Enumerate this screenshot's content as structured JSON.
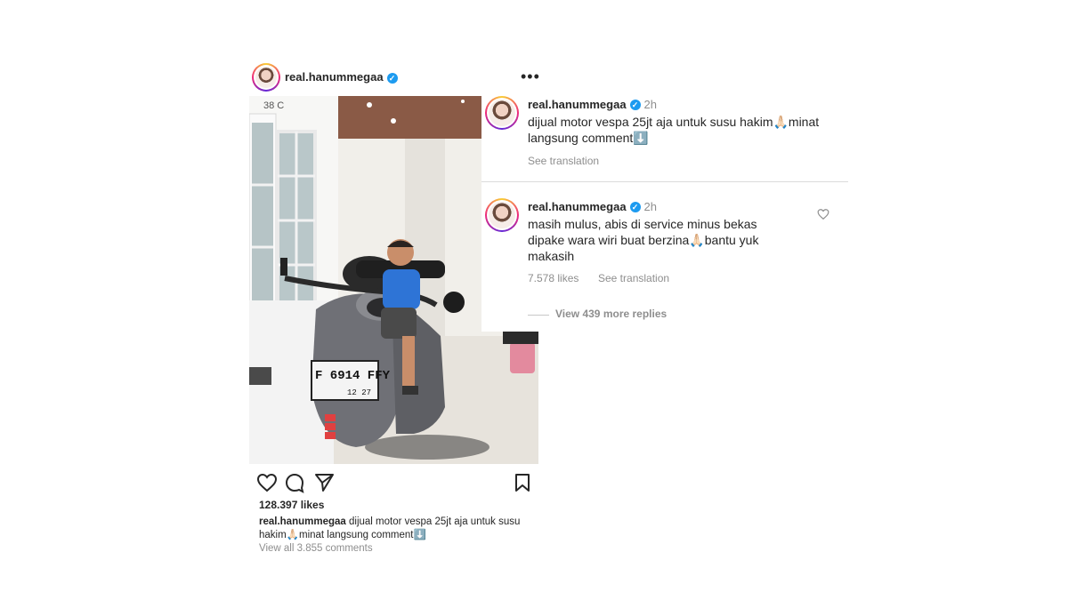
{
  "post": {
    "username": "real.hanummegaa",
    "verified_icon": "verified-badge-icon",
    "more_icon": "more-options-icon",
    "likes": "128.397 likes",
    "caption_user": "real.hanummegaa",
    "caption_line1": "dijual motor vespa 25jt aja untuk susu",
    "caption_line2": "hakim🙏🏻minat langsung comment⬇️",
    "view_comments": "View all 3.855 comments",
    "actions": [
      "heart-icon",
      "comment-icon",
      "share-icon",
      "bookmark-icon"
    ]
  },
  "photo": {
    "house_number": "38 C",
    "plate_main": "F 6914 FFY",
    "plate_sub": "12 27"
  },
  "comments": [
    {
      "username": "real.hanummegaa",
      "time": "2h",
      "line1": "dijual motor vespa 25jt aja untuk susu hakim🙏🏻minat",
      "line2": "langsung comment⬇️",
      "translation": "See translation"
    },
    {
      "username": "real.hanummegaa",
      "time": "2h",
      "line1": "masih mulus, abis di service minus bekas",
      "line2": "dipake wara wiri buat berzina🙏🏻bantu yuk",
      "line3": "makasih",
      "likes": "7.578 likes",
      "translation": "See translation",
      "view_replies": "View 439 more replies"
    }
  ],
  "colors": {
    "verified": "#1d9bf0",
    "text": "#262626",
    "muted": "#8e8e8e"
  }
}
